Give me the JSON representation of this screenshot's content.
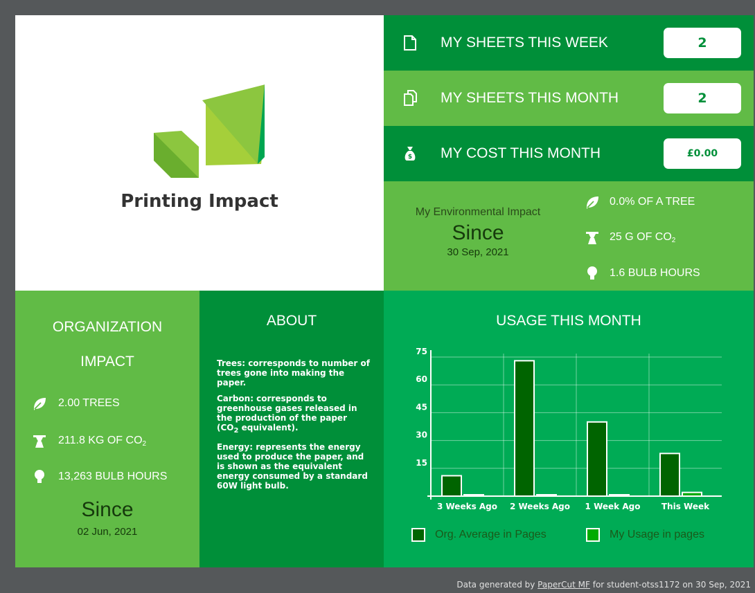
{
  "app": {
    "title": "Printing Impact",
    "logo": "green-leaves-logo"
  },
  "stats": [
    {
      "label": "MY SHEETS THIS WEEK",
      "value": "2",
      "icon": "sheet-icon"
    },
    {
      "label": "MY SHEETS THIS MONTH",
      "value": "2",
      "icon": "sheets-icon"
    },
    {
      "label": "MY COST THIS MONTH",
      "value": "£0.00",
      "icon": "money-bag-icon"
    }
  ],
  "environment": {
    "heading": "My Environmental Impact",
    "since_label": "Since",
    "since_date": "30 Sep, 2021",
    "items": [
      {
        "icon": "leaf-icon",
        "text": "0.0% OF A TREE"
      },
      {
        "icon": "factory-icon",
        "text": "25 G OF CO",
        "sub": "2"
      },
      {
        "icon": "bulb-icon",
        "text": "1.6 BULB HOURS"
      }
    ]
  },
  "organization": {
    "title_line1": "ORGANIZATION",
    "title_line2": "IMPACT",
    "items": [
      {
        "icon": "leaf-icon",
        "text": "2.00 TREES"
      },
      {
        "icon": "factory-icon",
        "text": "211.8 KG OF CO",
        "sub": "2"
      },
      {
        "icon": "bulb-icon",
        "text": "13,263 BULB HOURS"
      }
    ],
    "since_label": "Since",
    "since_date": "02 Jun, 2021"
  },
  "about": {
    "title": "ABOUT",
    "trees_term": "Trees:",
    "trees_text": " corresponds to number of trees gone into making the paper.",
    "carbon_term": "Carbon:",
    "carbon_text1": " corresponds to greenhouse gases released in the production of the paper (CO",
    "carbon_sub": "2",
    "carbon_text2": " equivalent).",
    "energy_term": "Energy:",
    "energy_text": " represents the energy used to produce the paper, and is shown as the equivalent energy consumed by a standard 60W light bulb."
  },
  "usage": {
    "title": "USAGE THIS MONTH",
    "legend": [
      "Org. Average in Pages",
      "My Usage in pages"
    ]
  },
  "chart_data": {
    "type": "bar",
    "categories": [
      "3 Weeks Ago",
      "2 Weeks Ago",
      "1 Week Ago",
      "This Week"
    ],
    "series": [
      {
        "name": "Org. Average in Pages",
        "values": [
          11,
          73,
          40,
          23
        ],
        "color": "#006400"
      },
      {
        "name": "My Usage in pages",
        "values": [
          0,
          0,
          0,
          2
        ],
        "color": "#00ab00"
      }
    ],
    "yticks": [
      15,
      30,
      45,
      60,
      75
    ],
    "ylim": [
      0,
      75
    ],
    "grid": true,
    "legend_position": "bottom"
  },
  "footer": {
    "prefix": "Data generated by ",
    "link": "PaperCut MF",
    "suffix": " for student-otss1172 on 30 Sep, 2021"
  },
  "colors": {
    "dark_green": "#008f39",
    "light_green": "#61bb46",
    "usage_green": "#00ab55",
    "background": "#55585a"
  }
}
